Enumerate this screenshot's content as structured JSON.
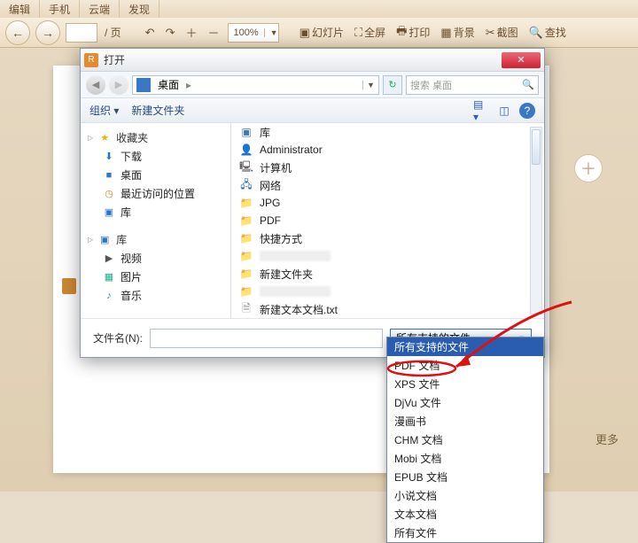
{
  "topbar": {
    "tabs": [
      "编辑",
      "手机",
      "云端",
      "发现"
    ]
  },
  "toolbar": {
    "page_suffix": "/ 页",
    "zoom": "100%",
    "btns": {
      "slideshow": "幻灯片",
      "fullscreen": "全屏",
      "print": "打印",
      "background": "背景",
      "screenshot": "截图",
      "find": "查找"
    }
  },
  "more": "更多",
  "dialog": {
    "title": "打开",
    "path_desktop": "桌面",
    "search_placeholder": "搜索 桌面",
    "org": "组织",
    "newfolder": "新建文件夹",
    "side": {
      "fav": "收藏夹",
      "downloads": "下载",
      "desktop": "桌面",
      "recent": "最近访问的位置",
      "libs": "库",
      "lib_hdr": "库",
      "video": "视频",
      "pictures": "图片",
      "music": "音乐"
    },
    "list": [
      {
        "icon": "f-lib",
        "name": "库"
      },
      {
        "icon": "f-user",
        "name": "Administrator"
      },
      {
        "icon": "f-pc",
        "name": "计算机"
      },
      {
        "icon": "f-net",
        "name": "网络"
      },
      {
        "icon": "f-fold",
        "name": "JPG"
      },
      {
        "icon": "f-fold",
        "name": "PDF"
      },
      {
        "icon": "f-lnk",
        "name": "快捷方式"
      },
      {
        "icon": "f-fold",
        "name": "",
        "blur": true
      },
      {
        "icon": "f-fold",
        "name": "新建文件夹"
      },
      {
        "icon": "f-fold",
        "name": "",
        "blur": true
      },
      {
        "icon": "f-txt",
        "name": "新建文本文档.txt"
      }
    ],
    "filename_label": "文件名(N):",
    "filter_selected": "所有支持的文件",
    "filter_options": [
      "所有支持的文件",
      "PDF 文档",
      "XPS 文件",
      "DjVu 文件",
      "漫画书",
      "CHM 文档",
      "Mobi 文档",
      "EPUB 文档",
      "小说文档",
      "文本文档",
      "所有文件"
    ],
    "highlight_option": "XPS 文件",
    "selected_option_index": 0
  }
}
